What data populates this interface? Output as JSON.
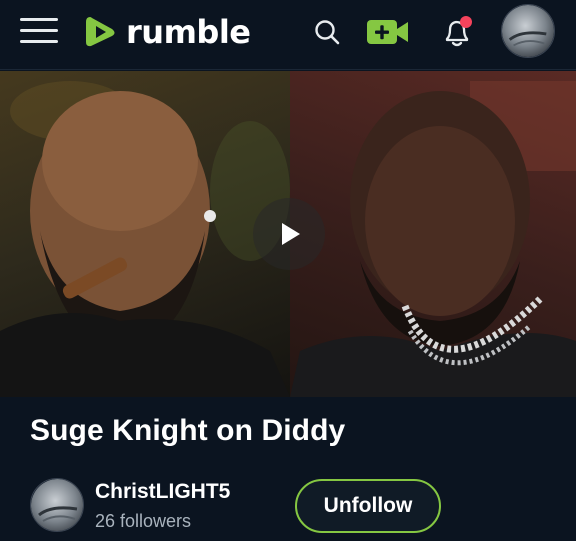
{
  "header": {
    "brand": "rumble",
    "brand_color": "#85c742",
    "icons": [
      "menu-icon",
      "rumble-logo-icon",
      "search-icon",
      "upload-video-icon",
      "notification-bell-icon",
      "avatar"
    ],
    "notification_dot_color": "#f5435c"
  },
  "video": {
    "title": "Suge Knight on Diddy",
    "play_icon": "play-icon"
  },
  "channel": {
    "name": "ChristLIGHT5",
    "followers": "26 followers",
    "follow_button_label": "Unfollow",
    "follow_button_border_color": "#85c742"
  }
}
